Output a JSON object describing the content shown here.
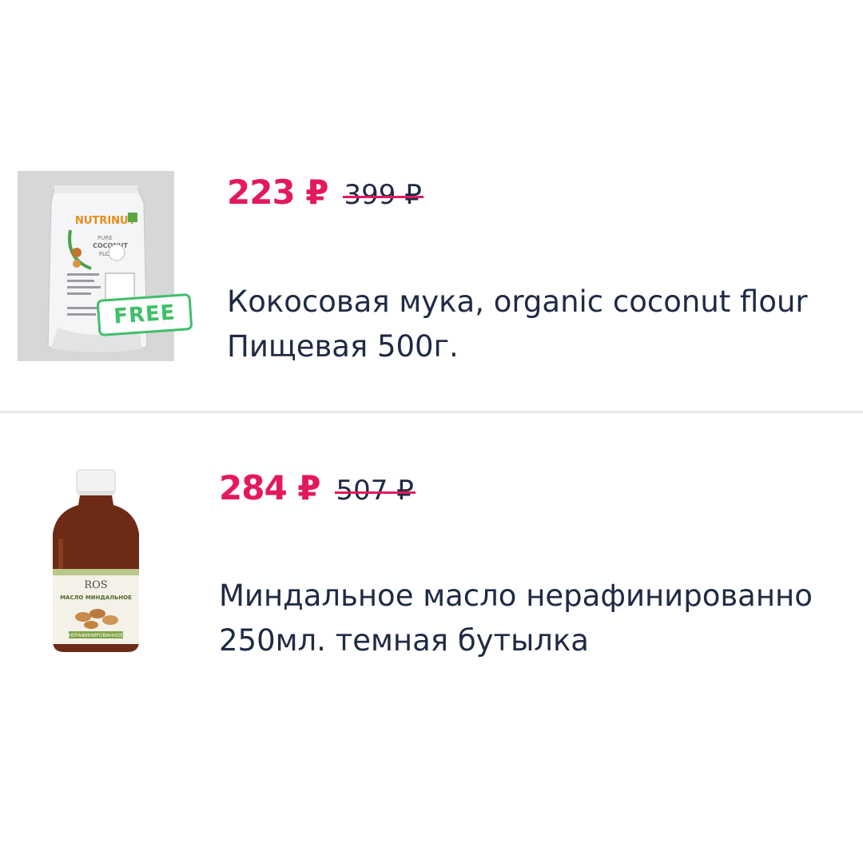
{
  "products": [
    {
      "price_new": "223 ₽",
      "price_old": "399 ₽",
      "title_line1": "Кокосовая мука, organic coconut flour",
      "title_line2": "Пищевая 500г.",
      "badge": "FREE",
      "image": {
        "brand": "NUTRINUT",
        "line1": "PURE",
        "line2": "COCONUT",
        "line3": "FLOUR"
      }
    },
    {
      "price_new": "284 ₽",
      "price_old": "507 ₽",
      "title_line1": "Миндальное масло нерафинированно",
      "title_line2": "250мл. темная бутылка",
      "image": {
        "brand": "ROS",
        "line1": "МАСЛО МИНДАЛЬНОЕ",
        "line2": "НЕРАФИНИРОВАННОЕ"
      }
    }
  ],
  "colors": {
    "price_accent": "#e3195c",
    "text": "#1f2a44",
    "badge": "#3fbf6a",
    "divider": "#e6e8ec"
  }
}
